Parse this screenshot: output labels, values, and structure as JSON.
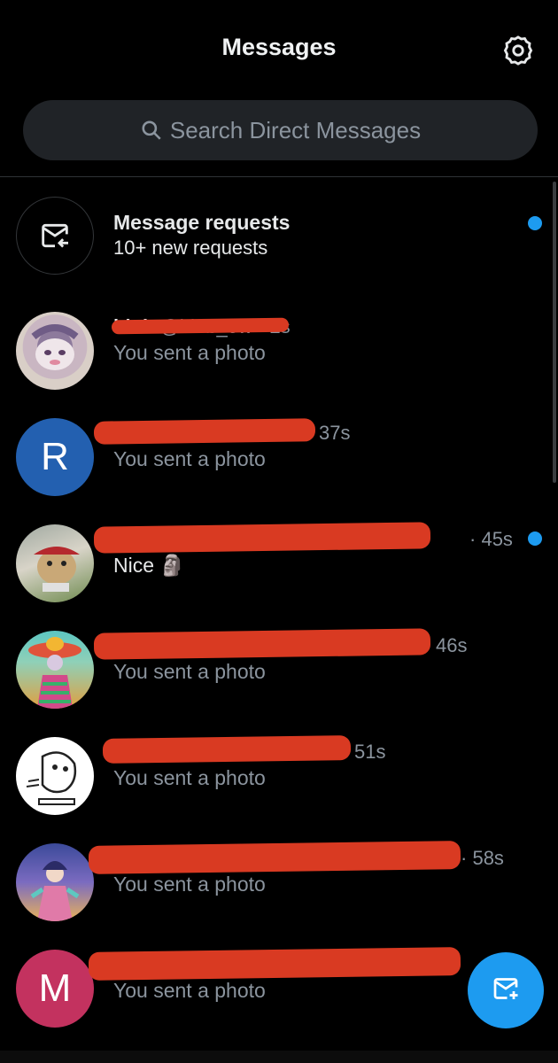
{
  "header": {
    "title": "Messages",
    "settings_icon": "gear-icon"
  },
  "search": {
    "placeholder": "Search Direct Messages",
    "icon": "search-icon"
  },
  "requests": {
    "title": "Message requests",
    "subtitle": "10+ new requests",
    "icon": "mail-return-icon",
    "unread": true
  },
  "conversations": [
    {
      "name": "blob",
      "handle": "@blob_ow",
      "time": "2s",
      "preview": "You sent a photo",
      "avatar": "image",
      "avatar_color": "#b9a3b8",
      "unread": false
    },
    {
      "name": "",
      "handle": "",
      "time": "37s",
      "preview": "You sent a photo",
      "avatar": "R",
      "avatar_color": "#2360b0",
      "unread": false
    },
    {
      "name": "",
      "handle": "",
      "time": "45s",
      "preview": "Nice 🗿",
      "avatar": "image",
      "avatar_color": "#6c8a4a",
      "unread": true
    },
    {
      "name": "",
      "handle": "",
      "time": "46s",
      "preview": "You sent a photo",
      "avatar": "image",
      "avatar_color": "#3ca0a0",
      "unread": false
    },
    {
      "name": "",
      "handle": "",
      "time": "51s",
      "preview": "You sent a photo",
      "avatar": "image",
      "avatar_color": "#ffffff",
      "unread": false
    },
    {
      "name": "",
      "handle": "",
      "time": "58s",
      "preview": "You sent a photo",
      "avatar": "image",
      "avatar_color": "#4b5fa8",
      "unread": false
    },
    {
      "name": "",
      "handle": "",
      "time": "",
      "preview": "You sent a photo",
      "avatar": "M",
      "avatar_color": "#c3325f",
      "unread": false
    }
  ],
  "fab": {
    "icon": "new-message-icon"
  },
  "colors": {
    "accent": "#1d9bf0",
    "redaction": "#d93a22",
    "background": "#000000"
  }
}
